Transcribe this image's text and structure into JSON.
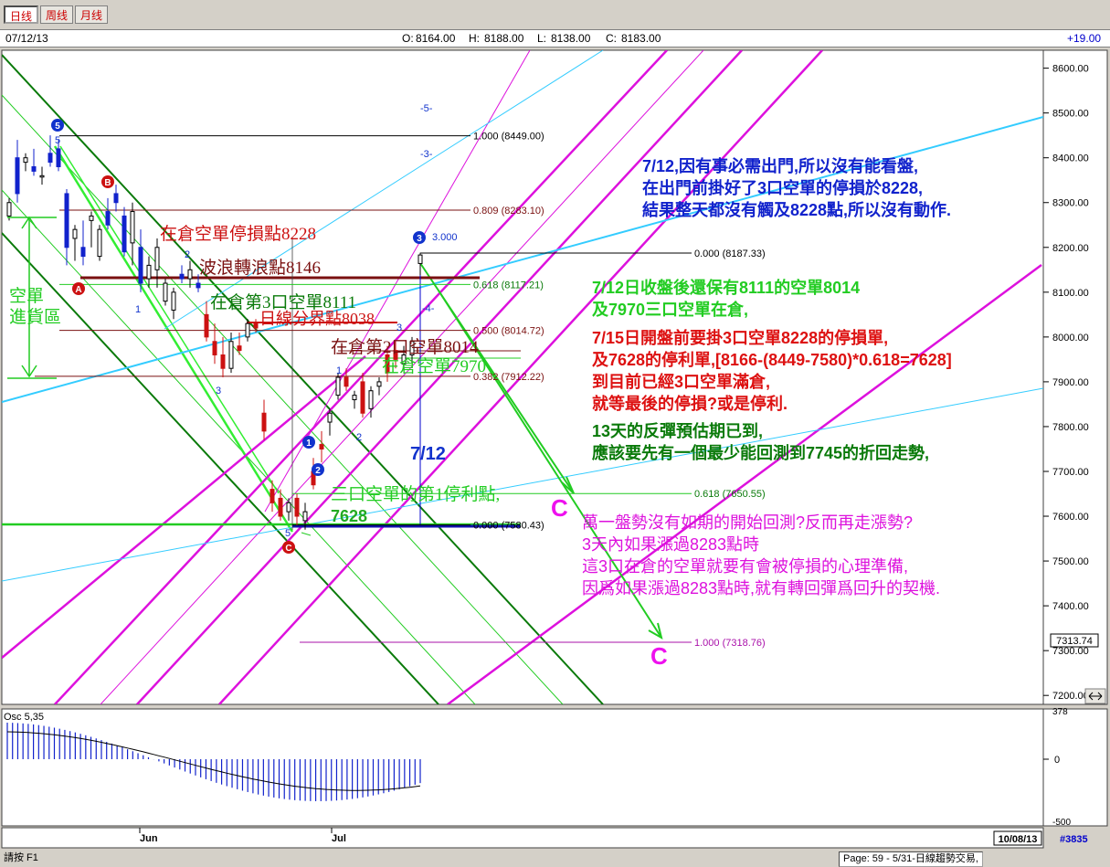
{
  "toolbar": {
    "tabs": [
      "日线",
      "周线",
      "月线"
    ]
  },
  "info": {
    "date": "07/12/13",
    "o_label": "O:",
    "o": "8164.00",
    "h_label": "H:",
    "h": "8188.00",
    "l_label": "L:",
    "l": "8138.00",
    "c_label": "C:",
    "c": "8183.00",
    "change": "+19.00"
  },
  "status": {
    "left": "請按 F1",
    "right": "Page: 59 - 5/31-日線趨勢交易,"
  },
  "bottom": {
    "date_box": "10/08/13",
    "bar_count": "#3835"
  },
  "chart_data": {
    "type": "candlestick",
    "y_axis": {
      "min": 7180,
      "max": 8640,
      "ticks": [
        "8600.00",
        "8500.00",
        "8400.00",
        "8300.00",
        "8200.00",
        "8100.00",
        "8000.00",
        "7900.00",
        "7800.00",
        "7700.00",
        "7600.00",
        "7500.00",
        "7400.00",
        "7300.00",
        "7200.00"
      ],
      "last_price": "7313.74"
    },
    "x_axis": {
      "labels": [
        "Jun",
        "Jul"
      ]
    },
    "candles": [
      [
        8270,
        8310,
        8260,
        8300
      ],
      [
        8400,
        8440,
        8300,
        8320
      ],
      [
        8390,
        8410,
        8370,
        8400
      ],
      [
        8380,
        8420,
        8360,
        8370
      ],
      [
        8360,
        8380,
        8340,
        8360
      ],
      [
        8410,
        8450,
        8380,
        8390
      ],
      [
        8420,
        8440,
        8370,
        8380
      ],
      [
        8320,
        8330,
        8160,
        8200
      ],
      [
        8220,
        8250,
        8170,
        8240
      ],
      [
        8200,
        8260,
        8160,
        8180
      ],
      [
        8260,
        8280,
        8200,
        8270
      ],
      [
        8180,
        8250,
        8170,
        8240
      ],
      [
        8280,
        8310,
        8240,
        8250
      ],
      [
        8320,
        8340,
        8280,
        8300
      ],
      [
        8270,
        8290,
        8180,
        8190
      ],
      [
        8210,
        8300,
        8160,
        8280
      ],
      [
        8200,
        8240,
        8100,
        8120
      ],
      [
        8130,
        8180,
        8110,
        8160
      ],
      [
        8150,
        8220,
        8110,
        8200
      ],
      [
        8080,
        8130,
        8070,
        8120
      ],
      [
        8060,
        8110,
        8040,
        8100
      ],
      [
        8140,
        8160,
        8120,
        8130
      ],
      [
        8130,
        8170,
        8110,
        8150
      ],
      [
        8120,
        8140,
        8100,
        8110
      ],
      [
        8050,
        8080,
        7990,
        8000
      ],
      [
        7990,
        8030,
        7940,
        7960
      ],
      [
        7960,
        8000,
        7910,
        7930
      ],
      [
        7930,
        8010,
        7920,
        7990
      ],
      [
        7980,
        8010,
        7960,
        7970
      ],
      [
        8000,
        8040,
        7990,
        8030
      ],
      [
        8030,
        8040,
        8010,
        8020
      ],
      [
        7830,
        7860,
        7770,
        7790
      ],
      [
        7660,
        7680,
        7610,
        7630
      ],
      [
        7640,
        7660,
        7590,
        7600
      ],
      [
        7610,
        7640,
        7590,
        7630
      ],
      [
        7640,
        7650,
        7580,
        7600
      ],
      [
        7590,
        7630,
        7570,
        7610
      ],
      [
        7700,
        7730,
        7660,
        7670
      ],
      [
        7760,
        7790,
        7720,
        7750
      ],
      [
        7810,
        7840,
        7780,
        7830
      ],
      [
        7870,
        7920,
        7860,
        7910
      ],
      [
        7910,
        7930,
        7880,
        7890
      ],
      [
        7860,
        7880,
        7840,
        7870
      ],
      [
        7900,
        7920,
        7820,
        7830
      ],
      [
        7840,
        7890,
        7820,
        7880
      ],
      [
        7890,
        7910,
        7870,
        7900
      ],
      [
        7960,
        7980,
        7900,
        7920
      ],
      [
        7970,
        7990,
        7930,
        7950
      ],
      [
        7940,
        7980,
        7920,
        7960
      ],
      [
        7960,
        8000,
        7940,
        7990
      ],
      [
        8164,
        8188,
        8138,
        8183
      ]
    ],
    "fib_levels": [
      {
        "label": "1.000 (8449.00)",
        "value": 8449
      },
      {
        "label": "0.809 (8283.10)",
        "value": 8283.1
      },
      {
        "label": "0.000 (8187.33)",
        "value": 8187.33
      },
      {
        "label": "0.618 (8117.21)",
        "value": 8117.21
      },
      {
        "label": "0.500 (8014.72)",
        "value": 8014.72
      },
      {
        "label": "0.382 (7912.22)",
        "value": 7912.22
      },
      {
        "label": "0.618 (7650.55)",
        "value": 7650.55
      },
      {
        "label": "0.000 (7580.43)",
        "value": 7580.43
      },
      {
        "label": "1.000 (7318.76)",
        "value": 7318.76
      }
    ],
    "text_labels": {
      "stop_loss": "在倉空單停損點8228",
      "wave_turn": "波浪轉浪點8146",
      "pos3": "在倉第3口空單8111",
      "daily_boundary": "日線分界點8038",
      "pos2": "在倉第2口空單8014",
      "pos1": "在倉空單7970",
      "take_profit": "三口空單的第1停利點,",
      "take_profit_val": "7628",
      "short_zone_1": "空單",
      "short_zone_2": "進貨區",
      "date_mark": "7/12",
      "wave_5_top": "-5-",
      "wave_3_top": "-3-",
      "wave_4_mid": "-4-",
      "wave_3_label": "3.000"
    },
    "waves": {
      "c1": "C",
      "c2": "C",
      "w5": "5",
      "wB": "B",
      "wA": "A",
      "wC": "C",
      "w1": "1",
      "w2": "2",
      "w3": "3"
    },
    "notes": {
      "blue": [
        "7/12,因有事必需出門,所以沒有能看盤,",
        "在出門前掛好了3口空單的停損於8228,",
        "結果整天都沒有觸及8228點,所以沒有動作."
      ],
      "green1": [
        "7/12日收盤後還保有8111的空單8014",
        "及7970三口空單在倉,"
      ],
      "red": [
        "7/15日開盤前要掛3口空單8228的停損單,",
        "及7628的停利單,[8166-(8449-7580)*0.618=7628]",
        "到目前已經3口空單滿倉,",
        "就等最後的停損?或是停利."
      ],
      "green2": [
        "13天的反彈預估期已到,",
        "應該要先有一個最少能回測到7745的折回走勢,"
      ],
      "magenta": [
        "萬一盤勢沒有如期的開始回測?反而再走漲勢?",
        "3天內如果漲過8283點時",
        "這3口在倉的空單就要有會被停損的心理準備,",
        "因爲如果漲過8283點時,就有轉回彈爲回升的契機."
      ]
    },
    "osc": {
      "label": "Osc 5,35",
      "ticks": [
        "378",
        "0",
        "-500"
      ]
    }
  }
}
